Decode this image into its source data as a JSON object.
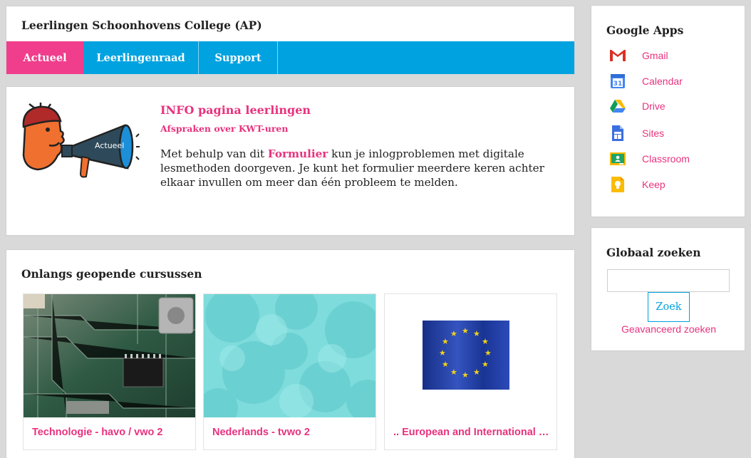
{
  "header": {
    "site_title": "Leerlingen Schoonhovens College (AP)",
    "tabs": [
      {
        "label": "Actueel",
        "active": true
      },
      {
        "label": "Leerlingenraad",
        "active": false
      },
      {
        "label": "Support",
        "active": false
      }
    ]
  },
  "info": {
    "title": "INFO pagina leerlingen",
    "subtitle": "Afspraken over KWT-uren",
    "body_before": "Met behulp van dit ",
    "body_link": "Formulier",
    "body_after": " kun je inlogproblemen met digitale lesmethoden doorgeven. Je kunt het formulier meerdere keren achter elkaar invullen om meer dan één probleem te melden.",
    "mascot_label": "Actueel"
  },
  "courses": {
    "title": "Onlangs geopende cursussen",
    "items": [
      {
        "name": "Technologie - havo / vwo 2",
        "image": "circuit-board"
      },
      {
        "name": "Nederlands - tvwo 2",
        "image": "teal-circles-pattern"
      },
      {
        "name": ".. European and International Orientation",
        "image": "eu-flag"
      }
    ]
  },
  "google_apps": {
    "title": "Google Apps",
    "items": [
      {
        "label": "Gmail",
        "icon": "gmail-icon"
      },
      {
        "label": "Calendar",
        "icon": "calendar-icon",
        "icon_text": "31"
      },
      {
        "label": "Drive",
        "icon": "drive-icon"
      },
      {
        "label": "Sites",
        "icon": "sites-icon"
      },
      {
        "label": "Classroom",
        "icon": "classroom-icon"
      },
      {
        "label": "Keep",
        "icon": "keep-icon"
      }
    ]
  },
  "search": {
    "title": "Globaal zoeken",
    "placeholder": "",
    "button_label": "Zoek",
    "advanced_link": "Geavanceerd zoeken"
  },
  "colors": {
    "accent_pink": "#e8327e",
    "nav_blue": "#00a2e0",
    "active_tab": "#f03d8c"
  }
}
